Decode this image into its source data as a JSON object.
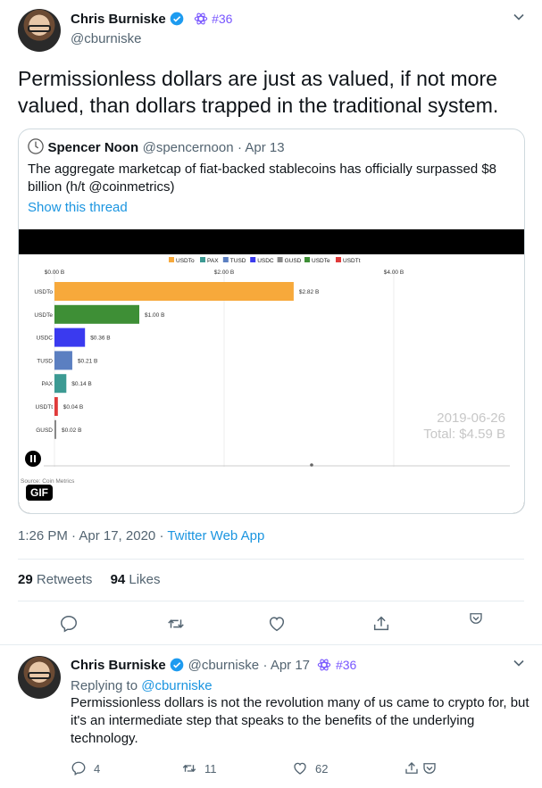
{
  "main_tweet": {
    "author_name": "Chris Burniske",
    "author_handle": "@cburniske",
    "rank_badge": "#36",
    "text": "Permissionless dollars are just as valued, if not more valued, than dollars trapped in the traditional system.",
    "timestamp": "1:26 PM · Apr 17, 2020",
    "source_sep": "·",
    "source": "Twitter Web App",
    "retweets_count": "29",
    "retweets_label": "Retweets",
    "likes_count": "94",
    "likes_label": "Likes"
  },
  "quoted_tweet": {
    "author_name": "Spencer Noon",
    "author_handle": "@spencernoon",
    "date": "· Apr 13",
    "text": "The aggregate marketcap of fiat-backed stablecoins has officially surpassed $8 billion (h/t @coinmetrics)",
    "show_thread": "Show this thread",
    "gif_label": "GIF",
    "colors": {
      "usdt_o": "#f7a93b",
      "usdt_e": "#3e8f36",
      "usdc": "#3a3aef",
      "tusd": "#5b7fc1",
      "pax": "#3c9a93",
      "usdt_t": "#e03a3a",
      "gusd": "#888888"
    }
  },
  "chart_data": {
    "type": "bar",
    "legend": [
      "USDTo",
      "PAX",
      "TUSD",
      "USDC",
      "GUSD",
      "USDTe",
      "USDTt"
    ],
    "axis_ticks": [
      "$0.00 B",
      "$2.00 B",
      "$4.00 B"
    ],
    "xlim": [
      0,
      4.0
    ],
    "categories": [
      "USDTo",
      "USDTe",
      "USDC",
      "TUSD",
      "PAX",
      "USDTt",
      "GUSD"
    ],
    "values": [
      2.82,
      1.0,
      0.36,
      0.21,
      0.14,
      0.04,
      0.02
    ],
    "value_labels": [
      "$2.82 B",
      "$1.00 B",
      "$0.36 B",
      "$0.21 B",
      "$0.14 B",
      "$0.04 B",
      "$0.02 B"
    ],
    "date": "2019-06-26",
    "total": "Total: $4.59 B",
    "source": "Source: Coin Metrics"
  },
  "reply_tweet": {
    "author_name": "Chris Burniske",
    "author_handle": "@cburniske",
    "date": "· Apr 17",
    "rank_badge": "#36",
    "replying_to_prefix": "Replying to",
    "replying_to_handle": "@cburniske",
    "text": "Permissionless dollars is not the revolution many of us came to crypto for, but it's an intermediate step that speaks to the benefits of the underlying technology.",
    "reply_count": "4",
    "retweet_count": "11",
    "like_count": "62"
  }
}
